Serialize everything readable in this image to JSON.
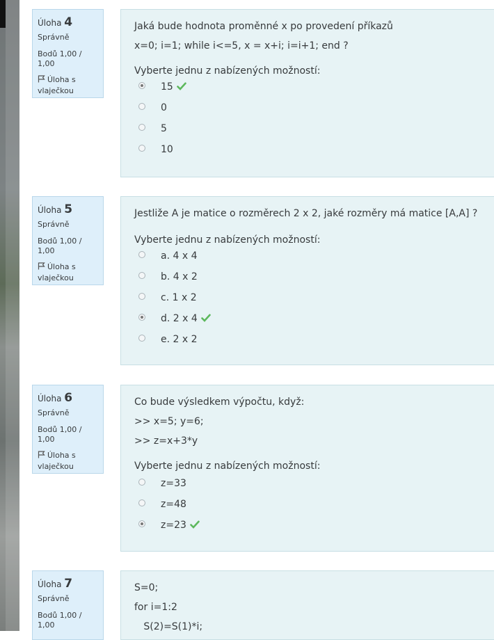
{
  "common": {
    "uloha_prefix": "Úloha",
    "status": "Správně",
    "marks": "Bodů 1,00 / 1,00",
    "flag_label": "Úloha s vlaječkou",
    "choose_prompt": "Vyberte jednu z nabízených možností:"
  },
  "questions": [
    {
      "number": "4",
      "text_lines": [
        "Jaká bude hodnota proměnné x po provedení příkazů",
        "x=0; i=1; while i<=5, x = x+i; i=i+1; end  ?"
      ],
      "options": [
        {
          "label": "15",
          "selected": true,
          "correct": true
        },
        {
          "label": "0",
          "selected": false,
          "correct": false
        },
        {
          "label": "5",
          "selected": false,
          "correct": false
        },
        {
          "label": "10",
          "selected": false,
          "correct": false
        }
      ]
    },
    {
      "number": "5",
      "text_lines": [
        "Jestliže A je matice o rozměrech 2 x 2, jaké rozměry má matice [A,A] ?"
      ],
      "options": [
        {
          "label": "a. 4 x 4",
          "selected": false,
          "correct": false
        },
        {
          "label": "b. 4 x 2",
          "selected": false,
          "correct": false
        },
        {
          "label": "c. 1 x 2",
          "selected": false,
          "correct": false
        },
        {
          "label": "d. 2 x 4",
          "selected": true,
          "correct": true
        },
        {
          "label": "e. 2 x 2",
          "selected": false,
          "correct": false
        }
      ]
    },
    {
      "number": "6",
      "text_lines": [
        "Co bude výsledkem výpočtu, když:",
        ">> x=5; y=6;",
        ">> z=x+3*y"
      ],
      "options": [
        {
          "label": "z=33",
          "selected": false,
          "correct": false
        },
        {
          "label": "z=48",
          "selected": false,
          "correct": false
        },
        {
          "label": "z=23",
          "selected": true,
          "correct": true
        }
      ]
    },
    {
      "number": "7",
      "text_lines": [
        "S=0;",
        "for i=1:2",
        "   S(2)=S(1)*i;"
      ],
      "options": []
    }
  ],
  "colors": {
    "correct_tick": "#5cb85c",
    "info_bg": "#deeffa",
    "content_bg": "#e7f3f5"
  }
}
